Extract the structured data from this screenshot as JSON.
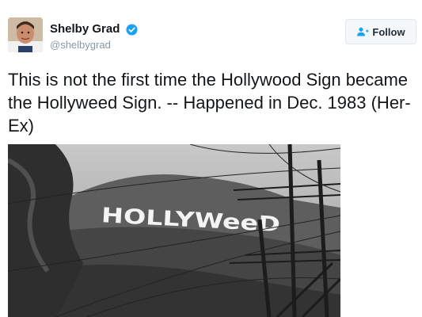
{
  "tweet": {
    "author": {
      "display_name": "Shelby Grad",
      "handle": "@shelbygrad",
      "verified": true
    },
    "follow_button": {
      "label": "Follow",
      "icon": "add-user-icon"
    },
    "text": "This is not the first time the Hollywood Sign became the Hollyweed Sign. -- Happened in Dec. 1983 (Her-Ex)",
    "media": {
      "sign_text": "HOLLYWeeD"
    }
  },
  "colors": {
    "verified_blue": "#1da1f2",
    "follow_icon_blue": "#1da1f2",
    "handle_gray": "#8899a6"
  }
}
